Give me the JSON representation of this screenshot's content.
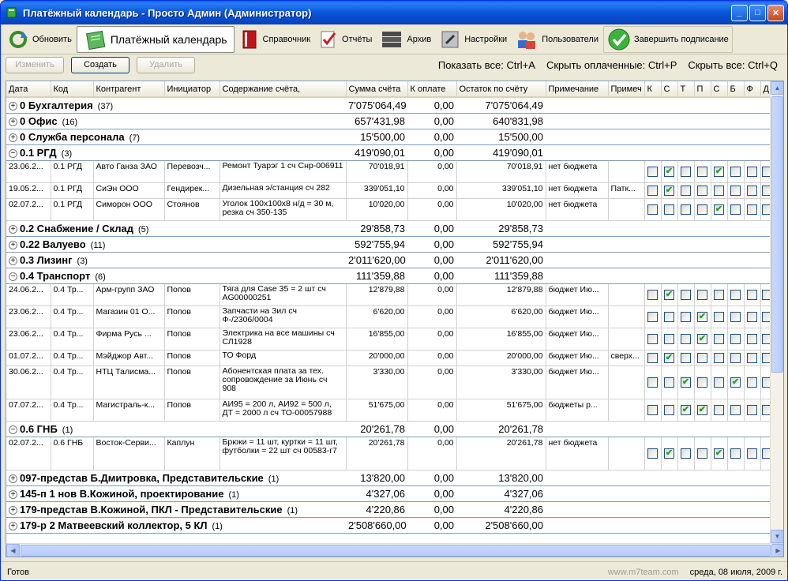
{
  "window": {
    "title": "Платёжный календарь - Просто Админ (Администратор)"
  },
  "toolbar": {
    "refresh": "Обновить",
    "calendar": "Платёжный календарь",
    "reference": "Справочник",
    "reports": "Отчёты",
    "archive": "Архив",
    "settings": "Настройки",
    "users": "Пользователи",
    "finish": "Завершить подписание"
  },
  "actions": {
    "edit": "Изменить",
    "create": "Создать",
    "delete": "Удалить"
  },
  "hotkeys": {
    "show_all": "Показать все: Ctrl+A",
    "hide_paid": "Скрыть оплаченные: Ctrl+P",
    "hide_all": "Скрыть все: Ctrl+Q"
  },
  "columns": [
    "Дата",
    "Код",
    "Контрагент",
    "Инициатор",
    "Содержание счёта,",
    "Сумма счёта",
    "К оплате",
    "Остаток по счёту",
    "Примечание",
    "Примеч",
    "К",
    "С",
    "Т",
    "П",
    "С",
    "Б",
    "Ф",
    "Д"
  ],
  "rows": [
    {
      "type": "group",
      "sign": "+",
      "name": "0 Бухгалтерия",
      "count": "(37)",
      "sum": "7'075'064,49",
      "pay": "0,00",
      "rest": "7'075'064,49"
    },
    {
      "type": "group",
      "sign": "+",
      "name": "0 Офис",
      "count": "(16)",
      "sum": "657'431,98",
      "pay": "0,00",
      "rest": "640'831,98"
    },
    {
      "type": "group",
      "sign": "+",
      "name": "0 Служба персонала",
      "count": "(7)",
      "sum": "15'500,00",
      "pay": "0,00",
      "rest": "15'500,00"
    },
    {
      "type": "group",
      "sign": "−",
      "name": "0.1 РГД",
      "count": "(3)",
      "sum": "419'090,01",
      "pay": "0,00",
      "rest": "419'090,01"
    },
    {
      "type": "item",
      "date": "23.06.2...",
      "code": "0.1 РГД",
      "contractor": "Авто Ганза ЗАО",
      "initiator": "Перевозч...",
      "content": "Ремонт Туарэг 1 сч Снр-006911",
      "sum": "70'018,91",
      "pay": "0,00",
      "rest": "70'018,91",
      "note": "нет бюджета",
      "note2": "",
      "checks": [
        0,
        1,
        0,
        0,
        1,
        0,
        0,
        0
      ]
    },
    {
      "type": "item",
      "date": "19.05.2...",
      "code": "0.1 РГД",
      "contractor": "СиЭн ООО",
      "initiator": "Гендирек...",
      "content": "Дизельная э/станция сч 282",
      "sum": "339'051,10",
      "pay": "0,00",
      "rest": "339'051,10",
      "note": "нет бюджета",
      "note2": "Патк...",
      "checks": [
        0,
        1,
        0,
        0,
        0,
        0,
        0,
        0
      ]
    },
    {
      "type": "item",
      "date": "02.07.2...",
      "code": "0.1 РГД",
      "contractor": "Симорон ООО",
      "initiator": "Стоянов",
      "content": "Уголок 100х100х8 н/д = 30 м, резка сч 350-135",
      "sum": "10'020,00",
      "pay": "0,00",
      "rest": "10'020,00",
      "note": "нет бюджета",
      "note2": "",
      "checks": [
        0,
        0,
        0,
        0,
        1,
        0,
        0,
        0
      ]
    },
    {
      "type": "group",
      "sign": "+",
      "name": "0.2 Снабжение / Склад",
      "count": "(5)",
      "sum": "29'858,73",
      "pay": "0,00",
      "rest": "29'858,73"
    },
    {
      "type": "group",
      "sign": "+",
      "name": "0.22 Валуево",
      "count": "(11)",
      "sum": "592'755,94",
      "pay": "0,00",
      "rest": "592'755,94"
    },
    {
      "type": "group",
      "sign": "+",
      "name": "0.3 Лизинг",
      "count": "(3)",
      "sum": "2'011'620,00",
      "pay": "0,00",
      "rest": "2'011'620,00"
    },
    {
      "type": "group",
      "sign": "−",
      "name": "0.4 Транспорт",
      "count": "(6)",
      "sum": "111'359,88",
      "pay": "0,00",
      "rest": "111'359,88"
    },
    {
      "type": "item",
      "date": "24.06.2...",
      "code": "0.4 Тр...",
      "contractor": "Арм-групп ЗАО",
      "initiator": "Попов",
      "content": "Тяга для Case 35 = 2 шт сч AG00000251",
      "sum": "12'879,88",
      "pay": "0,00",
      "rest": "12'879,88",
      "note": "бюджет Ию...",
      "note2": "",
      "checks": [
        0,
        1,
        0,
        0,
        0,
        0,
        0,
        0
      ]
    },
    {
      "type": "item",
      "date": "23.06.2...",
      "code": "0.4 Тр...",
      "contractor": "Магазин 01 О...",
      "initiator": "Попов",
      "content": "Запчасти на Зил сч Ф-/2306/0004",
      "sum": "6'620,00",
      "pay": "0,00",
      "rest": "6'620,00",
      "note": "бюджет Ию...",
      "note2": "",
      "checks": [
        0,
        0,
        0,
        1,
        0,
        0,
        0,
        0
      ]
    },
    {
      "type": "item",
      "date": "23.06.2...",
      "code": "0.4 Тр...",
      "contractor": "Фирма Русь ...",
      "initiator": "Попов",
      "content": "Электрика на все машины сч СЛ1928",
      "sum": "16'855,00",
      "pay": "0,00",
      "rest": "16'855,00",
      "note": "бюджет Ию...",
      "note2": "",
      "checks": [
        0,
        0,
        0,
        1,
        0,
        0,
        0,
        0
      ]
    },
    {
      "type": "item",
      "date": "01.07.2...",
      "code": "0.4 Тр...",
      "contractor": "Мэйджор Авт...",
      "initiator": "Попов",
      "content": "ТО Форд",
      "sum": "20'000,00",
      "pay": "0,00",
      "rest": "20'000,00",
      "note": "бюджет Ию...",
      "note2": "сверх...",
      "checks": [
        0,
        1,
        0,
        0,
        0,
        0,
        0,
        0
      ]
    },
    {
      "type": "item",
      "date": "30.06.2...",
      "code": "0.4 Тр...",
      "contractor": "НТЦ Талисма...",
      "initiator": "Попов",
      "content": "Абонентская плата за тех. сопровождение за Июнь сч 908",
      "sum": "3'330,00",
      "pay": "0,00",
      "rest": "3'330,00",
      "note": "бюджет Ию...",
      "note2": "",
      "checks": [
        0,
        0,
        1,
        0,
        0,
        1,
        0,
        0
      ]
    },
    {
      "type": "item",
      "date": "07.07.2...",
      "code": "0.4 Тр...",
      "contractor": "Магистраль-к...",
      "initiator": "Попов",
      "content": "АИ95 = 200 л, АИ92 = 500 л, ДТ = 2000 л сч ТО-00057988",
      "sum": "51'675,00",
      "pay": "0,00",
      "rest": "51'675,00",
      "note": "бюджеты р...",
      "note2": "",
      "checks": [
        0,
        0,
        1,
        1,
        0,
        0,
        0,
        0
      ]
    },
    {
      "type": "group",
      "sign": "−",
      "name": "0.6 ГНБ",
      "count": "(1)",
      "sum": "20'261,78",
      "pay": "0,00",
      "rest": "20'261,78"
    },
    {
      "type": "item",
      "date": "02.07.2...",
      "code": "0.6 ГНБ",
      "contractor": "Восток-Серви...",
      "initiator": "Каплун",
      "content": "Брюки = 11 шт, куртки = 11 шт, футболки = 22 шт сч 00583-г7",
      "sum": "20'261,78",
      "pay": "0,00",
      "rest": "20'261,78",
      "note": "нет бюджета",
      "note2": "",
      "checks": [
        0,
        1,
        0,
        0,
        1,
        0,
        0,
        0
      ]
    },
    {
      "type": "group",
      "sign": "+",
      "name": "097-представ Б.Дмитровка, Представительские",
      "count": "(1)",
      "sum": "13'820,00",
      "pay": "0,00",
      "rest": "13'820,00"
    },
    {
      "type": "group",
      "sign": "+",
      "name": "145-п 1 нов В.Кожиной, проектирование",
      "count": "(1)",
      "sum": "4'327,06",
      "pay": "0,00",
      "rest": "4'327,06"
    },
    {
      "type": "group",
      "sign": "+",
      "name": "179-представ В.Кожиной, ПКЛ - Представительские",
      "count": "(1)",
      "sum": "4'220,86",
      "pay": "0,00",
      "rest": "4'220,86"
    },
    {
      "type": "group",
      "sign": "+",
      "name": "179-р 2 Матвеевский коллектор, 5 КЛ",
      "count": "(1)",
      "sum": "2'508'660,00",
      "pay": "0,00",
      "rest": "2'508'660,00"
    }
  ],
  "status": {
    "left": "Готов",
    "site": "www.m7team.com",
    "date": "среда, 08 июля, 2009 г."
  }
}
